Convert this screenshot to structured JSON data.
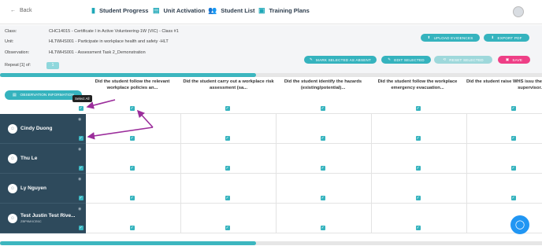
{
  "nav": {
    "back": "Back",
    "items": [
      {
        "label": "Student Progress",
        "icon": "chart-icon"
      },
      {
        "label": "Unit Activation",
        "icon": "document-icon"
      },
      {
        "label": "Student List",
        "icon": "people-icon"
      },
      {
        "label": "Training Plans",
        "icon": "clipboard-icon"
      }
    ],
    "user_icon": "user-icon"
  },
  "info": {
    "class_label": "Class:",
    "class_value": "CHC14015 - Certificate I in Active Volunteering-1W (VIC) - Class #1",
    "unit_label": "Unit:",
    "unit_value": "HLTWHS001 - Participate in workplace health and safety -HLT",
    "obs_label": "Observation:",
    "obs_value": "HLTWHS001 - Assessment Task 2_Demonstration",
    "repeat_label": "Repeat [1] of:",
    "repeat_value": "1"
  },
  "buttons": {
    "upload": "UPLOAD EVIDENCES",
    "export": "EXPORT PDF",
    "mark_absent": "MARK SELECTED AS ABSENT",
    "edit": "EDIT SELECTED",
    "reset": "RESET SELECTED",
    "save": "SAVE",
    "obs_info": "OBSERVATION INFORMATION"
  },
  "tooltip": "Select All",
  "columns": [
    "Did the student follow the relevant workplace policies an...",
    "Did the student carry out a workplace risk assessment (sa...",
    "Did the student identify the hazards (existing/potential)...",
    "Did the student follow the workplace emergency evacuation...",
    "Did the student raise WHS issu the supervisor."
  ],
  "students": [
    {
      "name": "Cindy Duong",
      "sub": ""
    },
    {
      "name": "Thu Le",
      "sub": ""
    },
    {
      "name": "Ly Nguyen",
      "sub": ""
    },
    {
      "name": "Test Justin Test Rive...",
      "sub": "ZBP9MXCE6C"
    }
  ],
  "colors": {
    "teal": "#35b3be",
    "pink": "#ee3f86",
    "student_bg": "#2e4a5c",
    "chat": "#2196f3"
  }
}
